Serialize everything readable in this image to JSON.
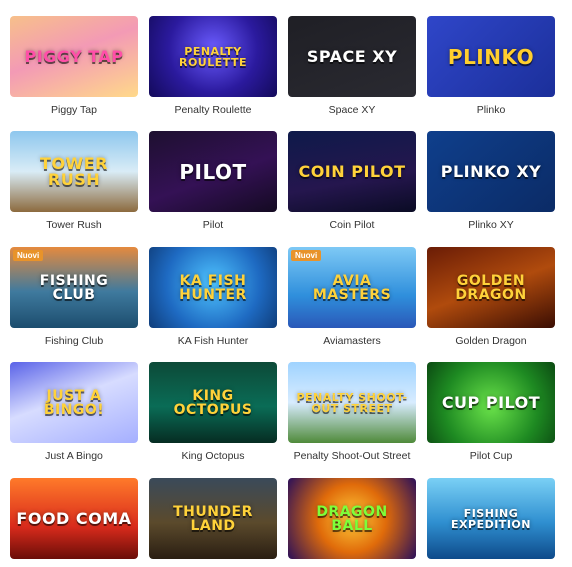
{
  "games": [
    {
      "title": "Piggy Tap",
      "thumb_text": "PIGGY TAP",
      "badge": "",
      "theme": "t-piggy",
      "text_color": "#ff4fa8"
    },
    {
      "title": "Penalty Roulette",
      "thumb_text": "PENALTY ROULETTE",
      "badge": "",
      "theme": "t-penalty",
      "text_color": "#ffd23a"
    },
    {
      "title": "Space XY",
      "thumb_text": "SPACE XY",
      "badge": "",
      "theme": "t-space",
      "text_color": "#ffffff"
    },
    {
      "title": "Plinko",
      "thumb_text": "PLINKO",
      "badge": "",
      "theme": "t-plinko",
      "text_color": "#ffcf2e"
    },
    {
      "title": "Tower Rush",
      "thumb_text": "TOWER RUSH",
      "badge": "",
      "theme": "t-tower",
      "text_color": "#ffd23a"
    },
    {
      "title": "Pilot",
      "thumb_text": "PILOT",
      "badge": "",
      "theme": "t-pilot",
      "text_color": "#ffffff"
    },
    {
      "title": "Coin Pilot",
      "thumb_text": "COIN PILOT",
      "badge": "",
      "theme": "t-coinpilot",
      "text_color": "#ffd23a"
    },
    {
      "title": "Plinko XY",
      "thumb_text": "PLINKO XY",
      "badge": "",
      "theme": "t-plinkoxy",
      "text_color": "#ffffff"
    },
    {
      "title": "Fishing Club",
      "thumb_text": "FISHING CLUB",
      "badge": "Nuovi",
      "theme": "t-fishing",
      "text_color": "#ffffff"
    },
    {
      "title": "KA Fish Hunter",
      "thumb_text": "KA FISH HUNTER",
      "badge": "",
      "theme": "t-kafish",
      "text_color": "#ffd23a"
    },
    {
      "title": "Aviamasters",
      "thumb_text": "AVIA MASTERS",
      "badge": "Nuovi",
      "theme": "t-avia",
      "text_color": "#ffd23a"
    },
    {
      "title": "Golden Dragon",
      "thumb_text": "GOLDEN DRAGON",
      "badge": "",
      "theme": "t-golden",
      "text_color": "#ffd23a"
    },
    {
      "title": "Just A Bingo",
      "thumb_text": "JUST A BINGO!",
      "badge": "",
      "theme": "t-bingo",
      "text_color": "#ffd23a"
    },
    {
      "title": "King Octopus",
      "thumb_text": "KING OCTOPUS",
      "badge": "",
      "theme": "t-king",
      "text_color": "#ffd23a"
    },
    {
      "title": "Penalty Shoot-Out Street",
      "thumb_text": "PENALTY SHOOT-OUT STREET",
      "badge": "",
      "theme": "t-shootout",
      "text_color": "#ffd23a"
    },
    {
      "title": "Pilot Cup",
      "thumb_text": "CUP PILOT",
      "badge": "",
      "theme": "t-pilotcup",
      "text_color": "#ffffff"
    },
    {
      "title": "",
      "thumb_text": "FOOD COMA",
      "badge": "",
      "theme": "t-food",
      "text_color": "#ffffff"
    },
    {
      "title": "",
      "thumb_text": "THUNDER LAND",
      "badge": "",
      "theme": "t-thunder",
      "text_color": "#ffd23a"
    },
    {
      "title": "",
      "thumb_text": "DRAGON BALL",
      "badge": "",
      "theme": "t-dragonball",
      "text_color": "#7dff3a"
    },
    {
      "title": "",
      "thumb_text": "FISHING EXPEDITION",
      "badge": "",
      "theme": "t-fishing2",
      "text_color": "#ffffff"
    }
  ]
}
